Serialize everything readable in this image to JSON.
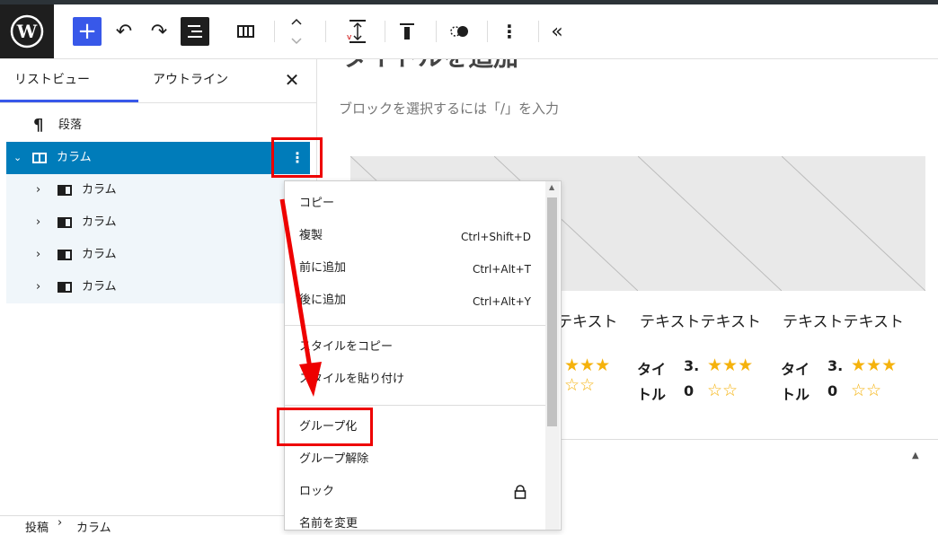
{
  "toolbar": {
    "add_label": "+",
    "undo_glyph": "↶",
    "redo_glyph": "↷",
    "collapse_glyph": "«",
    "more_glyph": "⋮"
  },
  "sidebar": {
    "tabs": [
      "リストビュー",
      "アウトライン"
    ],
    "close_glyph": "✕",
    "items": [
      {
        "label": "段落",
        "icon": "paragraph-icon"
      },
      {
        "label": "カラム",
        "icon": "columns-icon"
      },
      {
        "label": "カラム",
        "icon": "column-icon"
      },
      {
        "label": "カラム",
        "icon": "column-icon"
      },
      {
        "label": "カラム",
        "icon": "column-icon"
      },
      {
        "label": "カラム",
        "icon": "column-icon"
      }
    ],
    "breadcrumb": [
      "投稿",
      "カラム"
    ]
  },
  "canvas": {
    "title_partial": "タイトルを追加",
    "placeholder": "ブロックを選択するには「/」を入力",
    "card_text": [
      "テキスト",
      "テキストテキスト",
      "テキストテキスト"
    ],
    "card_title": [
      "タイ",
      "トル"
    ],
    "rating": [
      "3.",
      "0"
    ],
    "stars_full": "★★★",
    "stars_empty": "☆☆"
  },
  "menu": {
    "items": [
      {
        "label": "コピー",
        "shortcut": ""
      },
      {
        "label": "複製",
        "shortcut": "Ctrl+Shift+D"
      },
      {
        "label": "前に追加",
        "shortcut": "Ctrl+Alt+T"
      },
      {
        "label": "後に追加",
        "shortcut": "Ctrl+Alt+Y"
      },
      {
        "label": "スタイルをコピー",
        "shortcut": ""
      },
      {
        "label": "スタイルを貼り付け",
        "shortcut": ""
      },
      {
        "label": "グループ化",
        "shortcut": ""
      },
      {
        "label": "グループ解除",
        "shortcut": ""
      },
      {
        "label": "ロック",
        "shortcut": ""
      },
      {
        "label": "名前を変更",
        "shortcut": ""
      }
    ]
  },
  "colors": {
    "accent": "#3858e9",
    "selected_row": "#007cba",
    "annotation": "#e00000",
    "star": "#f5b20c"
  }
}
